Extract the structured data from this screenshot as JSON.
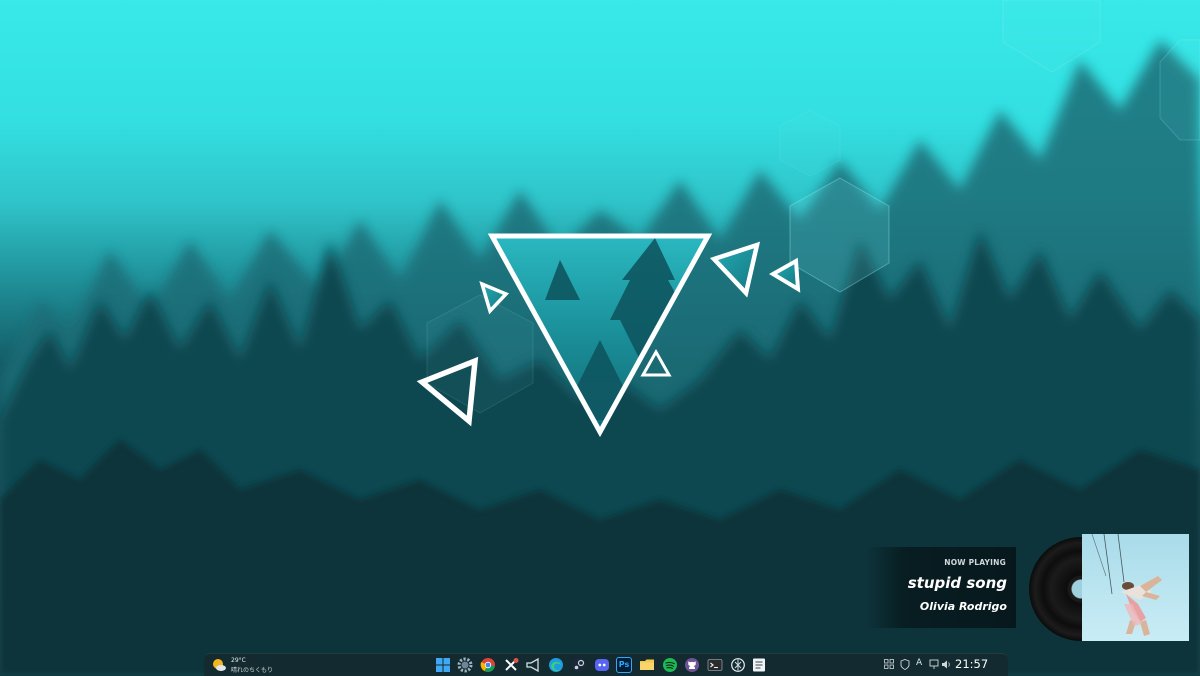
{
  "now_playing": {
    "header": "NOW PLAYING",
    "title": "stupid song",
    "artist": "Olivia Rodrigo"
  },
  "taskbar": {
    "weather": {
      "temperature": "29°C",
      "condition": "晴れのちくもり"
    },
    "pinned_icons": [
      "windows-start-icon",
      "settings-icon",
      "chrome-icon",
      "x-icon",
      "megaphone-icon",
      "edge-icon",
      "steam-icon",
      "discord-icon",
      "photoshop-icon",
      "file-explorer-icon",
      "spotify-icon",
      "github-icon",
      "terminal-icon",
      "chatgpt-icon",
      "notepad-icon"
    ],
    "photoshop_label": "Ps",
    "tray": {
      "ime_label": "A",
      "clock": "21:57"
    }
  },
  "colors": {
    "sky": "#38e9e9",
    "forest_dark": "#0b343c",
    "accent_white": "#ffffff",
    "spotify": "#1db954",
    "discord": "#5865f2",
    "photoshop": "#31a8ff",
    "edge": "#1f9be0"
  }
}
